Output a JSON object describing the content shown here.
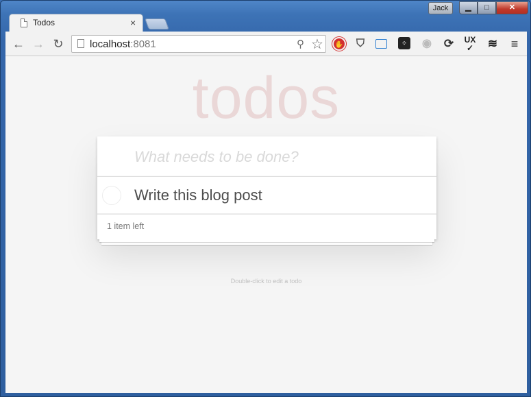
{
  "browser": {
    "profile_name": "Jack",
    "tab": {
      "title": "Todos"
    },
    "omnibox": {
      "host": "localhost",
      "port": ":8081"
    },
    "window_controls": {
      "minimize": "▁",
      "maximize": "□",
      "close": "✕"
    }
  },
  "app": {
    "title": "todos",
    "new_todo_placeholder": "What needs to be done?",
    "new_todo_value": "",
    "todos": [
      {
        "label": "Write this blog post",
        "completed": false
      }
    ],
    "items_left": "1 item left",
    "info": "Double-click to edit a todo"
  },
  "colors": {
    "title": "#af2f2f",
    "page_bg": "#f5f5f5",
    "window_frame": "#3a6fb5"
  }
}
